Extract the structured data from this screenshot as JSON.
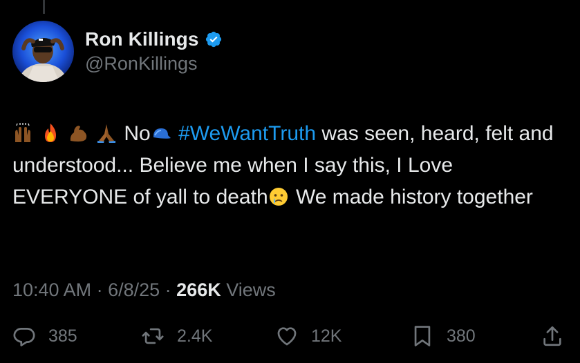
{
  "author": {
    "display_name": "Ron Killings",
    "handle": "@RonKillings",
    "verified": true,
    "avatar_icon": "avatar-photo"
  },
  "tweet": {
    "emojis_start": [
      "raising-hands-emoji",
      "fire-emoji",
      "flexed-biceps-emoji",
      "folded-hands-emoji"
    ],
    "text_before_cap": "No",
    "cap_emoji": "blue-cap-emoji",
    "hashtag": "#WeWantTruth",
    "text_after_hashtag": " was seen, heard, felt and understood... Believe me when I say this, I Love EVERYONE of yall to death",
    "crying_emoji": "crying-face-emoji",
    "text_end": " We made history together"
  },
  "meta": {
    "time": "10:40 AM",
    "separator": " · ",
    "date": "6/8/25",
    "views_count": "266K",
    "views_label": " Views"
  },
  "actions": {
    "replies": "385",
    "reposts": "2.4K",
    "likes": "12K",
    "bookmarks": "380"
  },
  "colors": {
    "background": "#000000",
    "text_primary": "#e7e9ea",
    "text_secondary": "#71767b",
    "accent": "#1d9bf0"
  }
}
